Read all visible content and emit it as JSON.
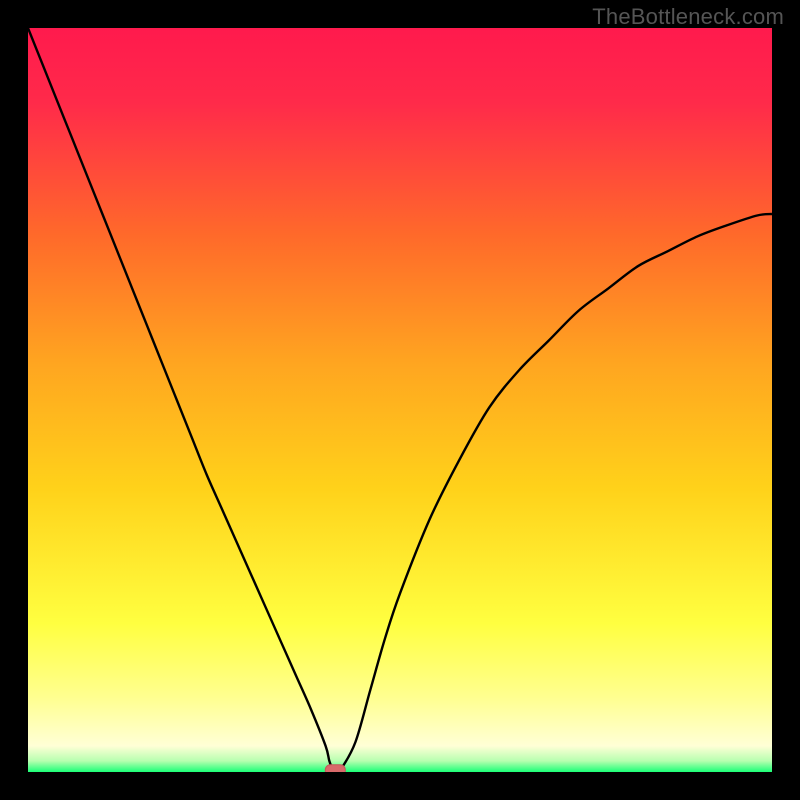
{
  "watermark": "TheBottleneck.com",
  "colors": {
    "bg_black": "#000000",
    "grad_top": "#ff1a4d",
    "grad_mid1": "#ff7a1a",
    "grad_mid2": "#ffd21a",
    "grad_mid3": "#ffff66",
    "grad_low_yellow": "#ffffcc",
    "grad_bottom_green": "#1bff77",
    "curve": "#000000",
    "marker": "#d86a6a"
  },
  "chart_data": {
    "type": "line",
    "title": "",
    "xlabel": "",
    "ylabel": "",
    "x": [
      0.0,
      0.02,
      0.04,
      0.06,
      0.08,
      0.1,
      0.12,
      0.14,
      0.16,
      0.18,
      0.2,
      0.22,
      0.24,
      0.26,
      0.28,
      0.3,
      0.32,
      0.34,
      0.36,
      0.38,
      0.4,
      0.405,
      0.41,
      0.415,
      0.42,
      0.44,
      0.46,
      0.48,
      0.5,
      0.54,
      0.58,
      0.62,
      0.66,
      0.7,
      0.74,
      0.78,
      0.82,
      0.86,
      0.9,
      0.94,
      0.98,
      1.0
    ],
    "values": [
      1.0,
      0.95,
      0.9,
      0.85,
      0.8,
      0.75,
      0.7,
      0.65,
      0.6,
      0.55,
      0.5,
      0.45,
      0.4,
      0.355,
      0.31,
      0.265,
      0.22,
      0.175,
      0.13,
      0.085,
      0.035,
      0.015,
      0.003,
      0.003,
      0.003,
      0.04,
      0.11,
      0.18,
      0.24,
      0.34,
      0.42,
      0.49,
      0.54,
      0.58,
      0.62,
      0.65,
      0.68,
      0.7,
      0.72,
      0.735,
      0.748,
      0.75
    ],
    "xlim": [
      0,
      1
    ],
    "ylim": [
      0,
      1
    ],
    "marker": {
      "x": 0.413,
      "y": 0.003
    },
    "gradient_stops": [
      {
        "offset": 0.0,
        "color": "#ff1a4d"
      },
      {
        "offset": 0.1,
        "color": "#ff2a4a"
      },
      {
        "offset": 0.28,
        "color": "#ff6a2a"
      },
      {
        "offset": 0.45,
        "color": "#ffa520"
      },
      {
        "offset": 0.62,
        "color": "#ffd21a"
      },
      {
        "offset": 0.8,
        "color": "#ffff40"
      },
      {
        "offset": 0.9,
        "color": "#ffff90"
      },
      {
        "offset": 0.965,
        "color": "#ffffd6"
      },
      {
        "offset": 0.985,
        "color": "#b8ffb0"
      },
      {
        "offset": 1.0,
        "color": "#1bff77"
      }
    ]
  }
}
